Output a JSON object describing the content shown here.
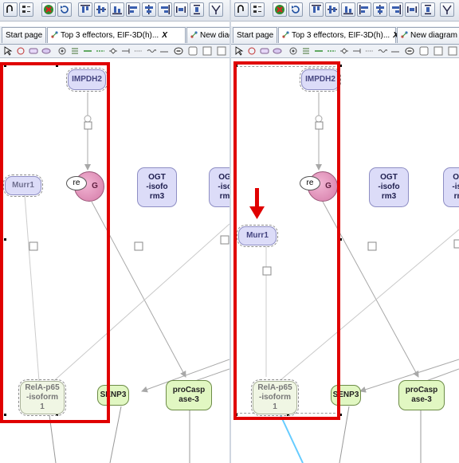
{
  "tabs": [
    {
      "label": "Start page",
      "icon": "none",
      "closable": false
    },
    {
      "label": "Top 3 effectors, EIF-3D(h)...",
      "icon": "diagram-icon",
      "closable": true
    },
    {
      "label": "New diagram",
      "icon": "diagram-icon",
      "closable": false
    }
  ],
  "close_symbol": "X",
  "nodes": {
    "impdh2": "IMPDH2",
    "murr1": "Murr1",
    "g_node": "G",
    "re_label": "re",
    "ogt_full": "OGT\n-isofo\nrm3",
    "ogt_clipped": "OG\n-isc\nrm",
    "rela": "RelA-p65\n-isoform\n1",
    "senp3": "SENP3",
    "procasp": "proCasp\nase-3"
  },
  "colors": {
    "highlight": "#e00000",
    "protein_fill": "#dcdcf8",
    "green_fill": "#e1f7c2",
    "selected_edge": "#66ccff"
  },
  "annotation": {
    "arrow": "red-down-arrow-icon"
  }
}
